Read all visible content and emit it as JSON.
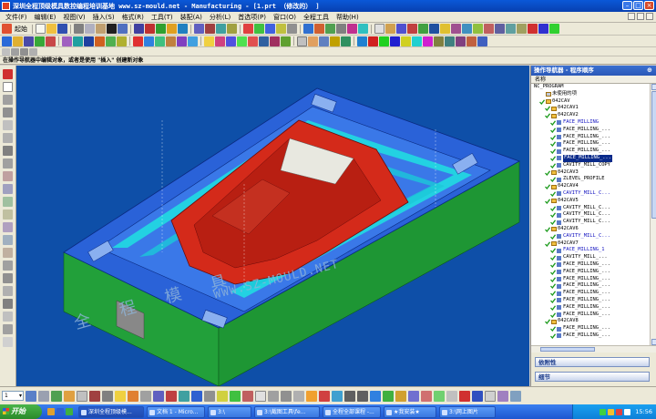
{
  "window": {
    "title": "深圳全程顶级模具数控编程培训基地 www.sz-mould.net - Manufacturing - [1.prt （修改的） ]",
    "controls": [
      "minimize",
      "maximize",
      "close"
    ]
  },
  "menu": {
    "items": [
      "文件(F)",
      "编辑(E)",
      "视图(V)",
      "插入(S)",
      "格式(R)",
      "工具(T)",
      "装配(A)",
      "分析(L)",
      "首选项(P)",
      "窗口(O)",
      "全程工具",
      "帮助(H)"
    ]
  },
  "toolbar": {
    "start_label": "起始",
    "icons": [
      "new-file",
      "open-file",
      "save",
      "cut",
      "copy",
      "paste",
      "delete",
      "undo",
      "create-program",
      "create-tool",
      "create-geometry",
      "create-method",
      "create-operation",
      "program-order-view",
      "machine-tool-view",
      "geometry-view",
      "machining-method-view",
      "generate-toolpath",
      "replay-toolpath",
      "verify-toolpath",
      "postprocess",
      "shop-docs"
    ]
  },
  "hint": "在操作导航器中编辑对象，或者是使用 \"插入\" 创建新对象",
  "viewport": {
    "watermark_cn": "全 程 模 具",
    "watermark_url": "WWW.SZ-MOULD.NET",
    "colors": {
      "background": "#0e4fa8",
      "top_face": "#2860d8",
      "side_face": "#22a03a",
      "core": "#d42a1a",
      "toolpath": "#20e0e0"
    }
  },
  "navigator": {
    "title": "操作导航器 - 程序顺序",
    "column": "名称",
    "tree": [
      {
        "label": "NC_PROGRAM",
        "depth": 0,
        "type": "root"
      },
      {
        "label": "未使用的项",
        "depth": 1,
        "type": "folder-plain"
      },
      {
        "label": "042CAV",
        "depth": 1,
        "type": "folder"
      },
      {
        "label": "042CAV1",
        "depth": 2,
        "type": "folder"
      },
      {
        "label": "042CAV2",
        "depth": 2,
        "type": "folder"
      },
      {
        "label": "FACE_MILLING",
        "depth": 3,
        "type": "op",
        "blue": true
      },
      {
        "label": "FACE_MILLING_...",
        "depth": 3,
        "type": "op"
      },
      {
        "label": "FACE_MILLING_...",
        "depth": 3,
        "type": "op"
      },
      {
        "label": "FACE_MILLING_...",
        "depth": 3,
        "type": "op"
      },
      {
        "label": "FACE_MILLING_...",
        "depth": 3,
        "type": "op"
      },
      {
        "label": "FACE_MILLING_...",
        "depth": 3,
        "type": "op",
        "selected": true
      },
      {
        "label": "CAVITY_MILL_COPY",
        "depth": 3,
        "type": "op"
      },
      {
        "label": "042CAV3",
        "depth": 2,
        "type": "folder"
      },
      {
        "label": "ZLEVEL_PROFILE",
        "depth": 3,
        "type": "op"
      },
      {
        "label": "042CAV4",
        "depth": 2,
        "type": "folder"
      },
      {
        "label": "CAVITY_MILL_C...",
        "depth": 3,
        "type": "op",
        "blue": true
      },
      {
        "label": "042CAV5",
        "depth": 2,
        "type": "folder"
      },
      {
        "label": "CAVITY_MILL_C...",
        "depth": 3,
        "type": "op"
      },
      {
        "label": "CAVITY_MILL_C...",
        "depth": 3,
        "type": "op"
      },
      {
        "label": "CAVITY_MILL_C...",
        "depth": 3,
        "type": "op"
      },
      {
        "label": "042CAV6",
        "depth": 2,
        "type": "folder"
      },
      {
        "label": "CAVITY_MILL_C...",
        "depth": 3,
        "type": "op",
        "blue": true
      },
      {
        "label": "042CAV7",
        "depth": 2,
        "type": "folder"
      },
      {
        "label": "FACE_MILLING_1",
        "depth": 3,
        "type": "op",
        "blue": true
      },
      {
        "label": "CAVITY_MILL_...",
        "depth": 3,
        "type": "op"
      },
      {
        "label": "FACE_MILLING_...",
        "depth": 3,
        "type": "op"
      },
      {
        "label": "FACE_MILLING_...",
        "depth": 3,
        "type": "op"
      },
      {
        "label": "FACE_MILLING_...",
        "depth": 3,
        "type": "op"
      },
      {
        "label": "FACE_MILLING_...",
        "depth": 3,
        "type": "op"
      },
      {
        "label": "FACE_MILLING_...",
        "depth": 3,
        "type": "op"
      },
      {
        "label": "FACE_MILLING_...",
        "depth": 3,
        "type": "op"
      },
      {
        "label": "FACE_MILLING_...",
        "depth": 3,
        "type": "op"
      },
      {
        "label": "FACE_MILLING_...",
        "depth": 3,
        "type": "op"
      },
      {
        "label": "042CAV8",
        "depth": 2,
        "type": "folder"
      },
      {
        "label": "FACE_MILLING_...",
        "depth": 3,
        "type": "op"
      },
      {
        "label": "FACE_MILLING_...",
        "depth": 3,
        "type": "op"
      }
    ],
    "sections": [
      "依附性",
      "细节"
    ]
  },
  "statusbar": {
    "layer_select": "1"
  },
  "taskbar": {
    "start": "开始",
    "tasks": [
      {
        "label": "深圳全程顶级模...",
        "active": true
      },
      {
        "label": "文档 1 - Micro...",
        "active": false
      },
      {
        "label": "3:\\",
        "active": false
      },
      {
        "label": "3:\\截图工具\\fe...",
        "active": false
      },
      {
        "label": "全程全部课程 -...",
        "active": false
      },
      {
        "label": "★我安装★",
        "active": false
      },
      {
        "label": "3:\\网上图片",
        "active": false
      }
    ],
    "clock": "15:56"
  }
}
